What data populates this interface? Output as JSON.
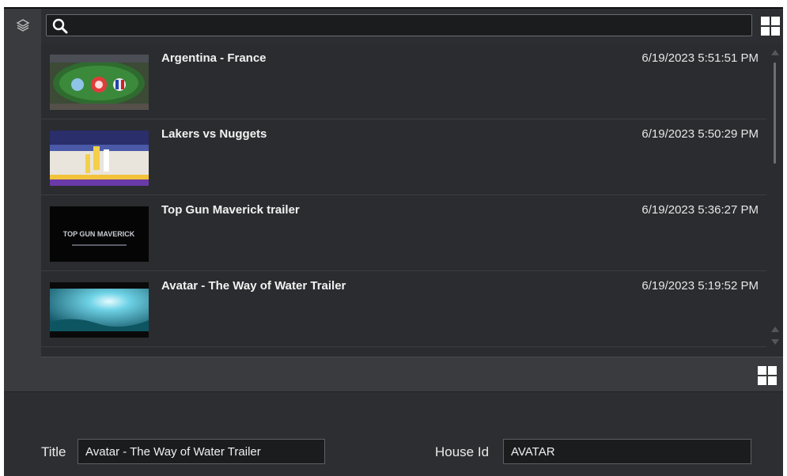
{
  "search": {
    "value": "",
    "placeholder": ""
  },
  "items": [
    {
      "title": "Argentina - France",
      "date": "6/19/2023 5:51:51 PM",
      "thumbnail": "soccer-match"
    },
    {
      "title": "Lakers vs Nuggets",
      "date": "6/19/2023 5:50:29 PM",
      "thumbnail": "basketball-game"
    },
    {
      "title": "Top Gun Maverick trailer",
      "date": "6/19/2023 5:36:27 PM",
      "thumbnail": "top-gun-logo",
      "logo_text": "TOP GUN MAVERICK"
    },
    {
      "title": "Avatar - The Way of Water Trailer",
      "date": "6/19/2023 5:19:52 PM",
      "thumbnail": "underwater-scene"
    }
  ],
  "form": {
    "title_label": "Title",
    "title_value": "Avatar - The Way of Water Trailer",
    "house_id_label": "House Id",
    "house_id_value": "AVATAR"
  },
  "icons": {
    "layers": "layers-icon",
    "search": "search-icon",
    "grid_top": "grid-view-icon",
    "grid_bottom": "grid-view-icon"
  },
  "colors": {
    "background": "#2d2e31",
    "input_bg": "#1b1c1e",
    "sidebar": "#3a3b3f"
  }
}
